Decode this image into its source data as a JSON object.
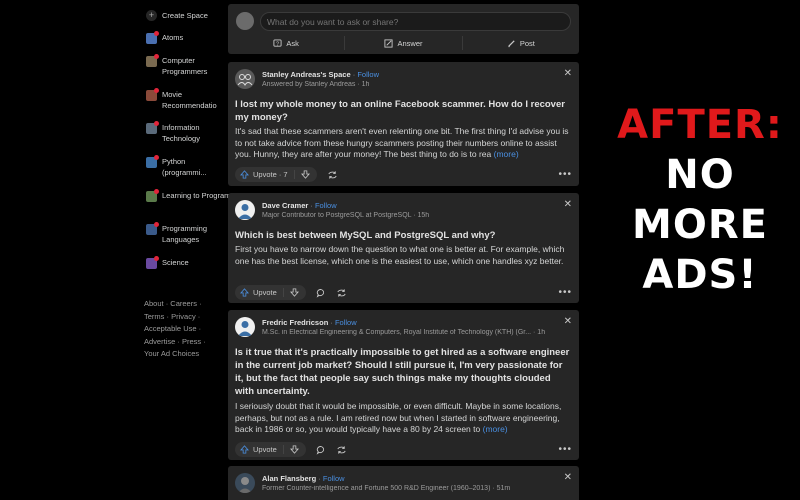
{
  "sidebar": {
    "create_space": "Create Space",
    "items": [
      {
        "label": "Atoms",
        "icon": "atoms-space-icon",
        "color": "#4a6fb0"
      },
      {
        "label": "Computer Programmers",
        "icon": "computer-programmers-space-icon",
        "color": "#7a6a50"
      },
      {
        "label": "Movie Recommendatio",
        "icon": "movie-space-icon",
        "color": "#8a4a3a"
      },
      {
        "label": "Information Technology",
        "icon": "information-technology-space-icon",
        "color": "#5a6a7a"
      },
      {
        "label": "Python (programmi...",
        "icon": "python-space-icon",
        "color": "#3a6ea5"
      },
      {
        "label": "Learning to Program",
        "icon": "learning-to-program-space-icon",
        "color": "#5a7a4a"
      },
      {
        "label": "Programming Languages",
        "icon": "programming-languages-space-icon",
        "color": "#3a5a8a"
      },
      {
        "label": "Science",
        "icon": "science-space-icon",
        "color": "#6a4aa0"
      }
    ],
    "footer": {
      "about": "About",
      "careers": "Careers",
      "terms": "Terms",
      "privacy": "Privacy",
      "acceptable_use": "Acceptable Use",
      "advertise": "Advertise",
      "press": "Press",
      "ad_choices": "Your Ad Choices",
      "sep": " ·"
    }
  },
  "ask_box": {
    "placeholder": "What do you want to ask or share?",
    "ask": "Ask",
    "answer": "Answer",
    "post": "Post"
  },
  "posts": [
    {
      "name": "Stanley Andreas's Space",
      "follow": "Follow",
      "sub": "Answered by Stanley Andreas · 1h",
      "title": "I lost my whole money to an online Facebook scammer. How do I recover my money?",
      "answer": "It's sad that these scammers aren't even relenting one bit. The first thing I'd advise you is to not take advice from these hungry scammers posting their numbers online to assist you. Hunny, they are after your money! The best thing to do is to rea",
      "more": "(more)",
      "upvote": "Upvote · 7"
    },
    {
      "name": "Dave Cramer",
      "follow": "Follow",
      "sub": "Major Contributor to PostgreSQL at PostgreSQL · 15h",
      "title": "Which is best between MySQL and PostgreSQL and why?",
      "answer": "First you have to narrow down the question to what one is better at. For example, which one has the best license, which one is the easiest to use, which one handles xyz better.",
      "more": "",
      "upvote": "Upvote"
    },
    {
      "name": "Fredric Fredricson",
      "follow": "Follow",
      "sub": "M.Sc. in Electrical Engineering & Computers, Royal Institute of Technology (KTH) (Gr... · 1h",
      "title": "Is it true that it's practically impossible to get hired as a software engineer in the current job market? Should I still pursue it, I'm very passionate for it, but the fact that people say such things make my thoughts clouded with uncertainty.",
      "answer": "I seriously doubt that it would be impossible, or even difficult. Maybe in some locations, perhaps, but not as a rule. I am retired now but when I started in software engineering, back in 1986 or so, you would typically have a 80 by 24 screen to",
      "more": "(more)",
      "upvote": "Upvote"
    },
    {
      "name": "Alan Flansberg",
      "follow": "Follow",
      "sub": "Former Counter-intelligence and Fortune 500 R&D Engineer (1960–2013) · 51m"
    }
  ],
  "banner": {
    "line1": "AFTER:",
    "line2": "NO",
    "line3": "MORE",
    "line4": "ADS!"
  },
  "colors": {
    "accent": "#4a8fe0",
    "card": "#262626",
    "banner_red": "#e0191b"
  }
}
